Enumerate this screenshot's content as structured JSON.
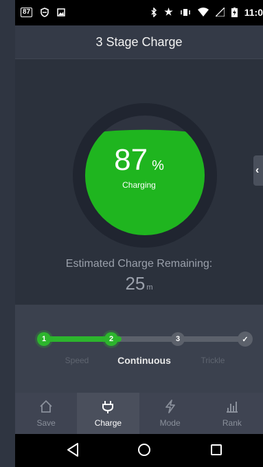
{
  "status_bar": {
    "battery_badge": "87",
    "time": "11:0",
    "icons": [
      "battery-badge-icon",
      "shield-icon",
      "image-icon",
      "bluetooth-icon",
      "star-icon",
      "vibrate-icon",
      "wifi-icon",
      "signal-icon",
      "battery-charging-icon"
    ]
  },
  "app_bar": {
    "title": "3 Stage Charge"
  },
  "gauge": {
    "percent": "87",
    "percent_symbol": "%",
    "status": "Charging",
    "fill_fraction": 0.87,
    "colors": {
      "ring": "#202530",
      "fill": "#1fb51f",
      "empty": "#2f3440"
    }
  },
  "estimate": {
    "label": "Estimated Charge Remaining:",
    "value": "25",
    "unit": "m"
  },
  "stages": {
    "nodes": [
      "1",
      "2",
      "3",
      "✓"
    ],
    "labels": [
      "Speed",
      "Continuous",
      "Trickle"
    ],
    "active_index": 1,
    "progress_fraction": 0.5
  },
  "nav_tabs": [
    {
      "label": "Save",
      "icon": "home-icon"
    },
    {
      "label": "Charge",
      "icon": "plug-icon"
    },
    {
      "label": "Mode",
      "icon": "lightning-icon"
    },
    {
      "label": "Rank",
      "icon": "bar-chart-icon"
    }
  ],
  "active_tab": "Charge",
  "system_nav": [
    "back-icon",
    "home-circle-icon",
    "recents-icon"
  ]
}
